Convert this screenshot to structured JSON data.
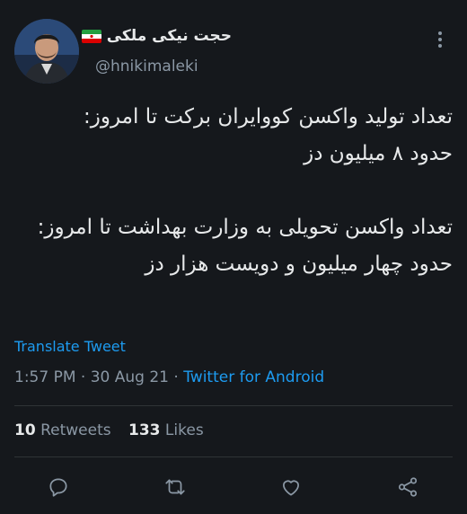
{
  "tweet": {
    "author_name": "حجت نیکی ملکی",
    "handle": "@hnikimaleki",
    "body": "تعداد تولید واکسن کوو‌ایران برکت تا امروز:\nحدود ۸ میلیون دز\n\nتعداد واکسن تحویلی به وزارت بهداشت تا امروز:\nحدود چهار میلیون و دویست هزار دز",
    "translate_label": "Translate Tweet",
    "time": "1:57 PM",
    "separator": " · ",
    "date": "30 Aug 21",
    "source": "Twitter for Android",
    "retweets_count": "10",
    "retweets_label": "Retweets",
    "likes_count": "133",
    "likes_label": "Likes"
  },
  "icons": {
    "more": "more-vertical-icon",
    "reply": "reply-icon",
    "retweet": "retweet-icon",
    "like": "heart-icon",
    "share": "share-icon",
    "flag": "iran-flag-icon"
  },
  "colors": {
    "background": "#15181c",
    "text": "#e7e9ea",
    "secondary": "#8b98a5",
    "link": "#1d9bf0"
  }
}
